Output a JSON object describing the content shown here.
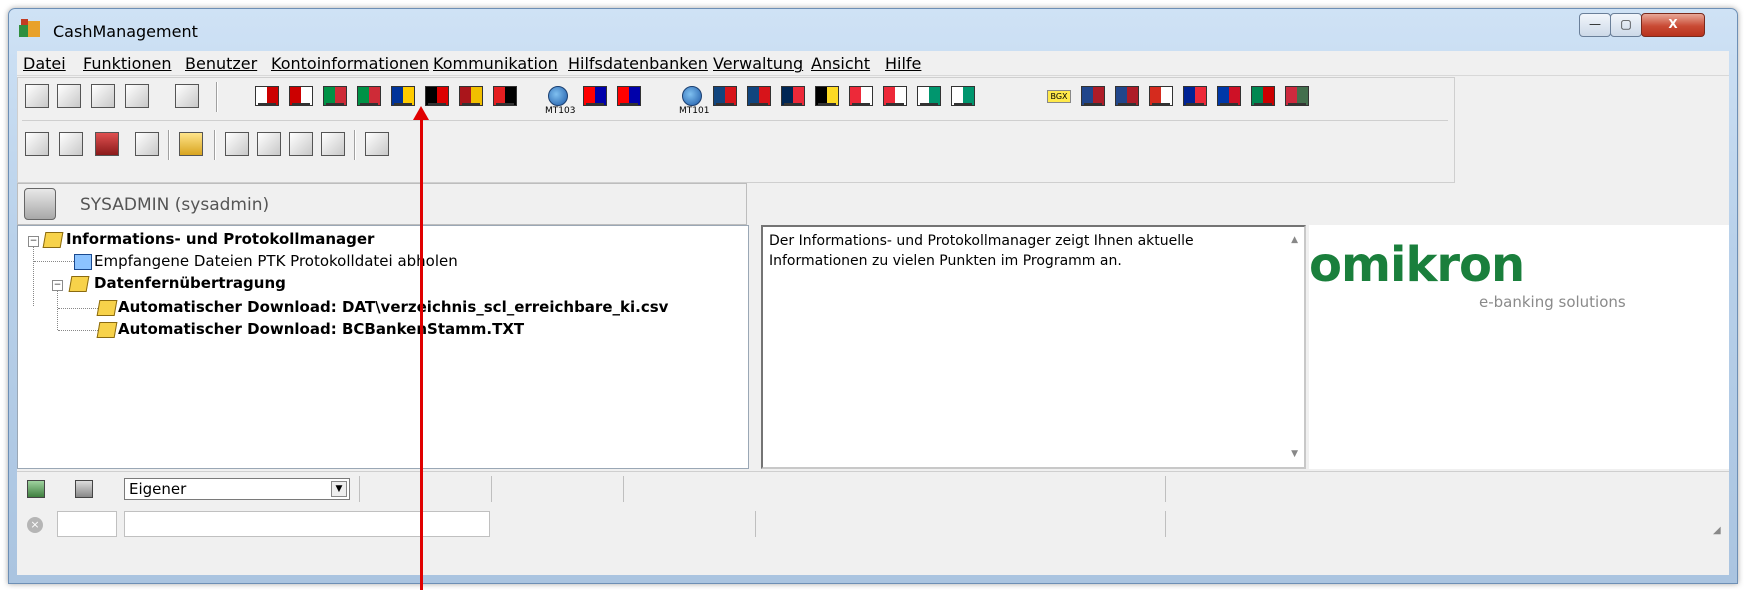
{
  "window": {
    "title": "CashManagement",
    "buttons": {
      "minimize": "—",
      "maximize": "▢",
      "close": "X"
    }
  },
  "menu": {
    "items": [
      "Datei",
      "Funktionen",
      "Benutzer",
      "Kontoinformationen",
      "Kommunikation",
      "Hilfsdatenbanken",
      "Verwaltung",
      "Ansicht",
      "Hilfe"
    ]
  },
  "toolbar": {
    "mt103": "MT103",
    "mt101": "MT101",
    "bgx": "BGX",
    "flag_colors": [
      "#ffffff,#cc0000",
      "#cc0000,#ffffff",
      "#009246,#ce2b37",
      "#009246,#ce2b37",
      "#003399,#ffcc00",
      "#000000,#dd0000",
      "#aa151b,#f1bf00",
      "#e41e20,#000000",
      "#ff0000,#0000aa",
      "#ff0000,#0000aa",
      "#11457e,#d7141a",
      "#11457e,#d7141a",
      "#002654,#ed2939",
      "#000000,#fdda24",
      "#ed2939,#ffffff",
      "#ed2939,#ffffff",
      "#ffffff,#00966e",
      "#ffffff,#00966e",
      "#21468b,#ae1c28",
      "#21468b,#ae1c28",
      "#d52b1e,#ffffff",
      "#002395,#ed2939",
      "#0038a8,#ce1126",
      "#008751,#cc0000",
      "#cd2a3e,#436f4d"
    ]
  },
  "user": {
    "label": "SYSADMIN (sysadmin)"
  },
  "tree": {
    "root": "Informations- und Protokollmanager",
    "child1": "Empfangene Dateien PTK Protokolldatei abholen",
    "child2": "Datenfernübertragung",
    "grandchild1": "Automatischer Download: DAT\\verzeichnis_scl_erreichbare_ki.csv",
    "grandchild2": "Automatischer Download: BCBankenStamm.TXT"
  },
  "info": {
    "text": "Der Informations- und Protokollmanager zeigt Ihnen aktuelle Informationen zu vielen Punkten im Programm an."
  },
  "logo": {
    "word": "omikron",
    "tagline": "e-banking solutions"
  },
  "status": {
    "combo_value": "Eigener"
  },
  "colors": {
    "annotation": "#e00000",
    "logo_green": "#1a7f3c"
  }
}
